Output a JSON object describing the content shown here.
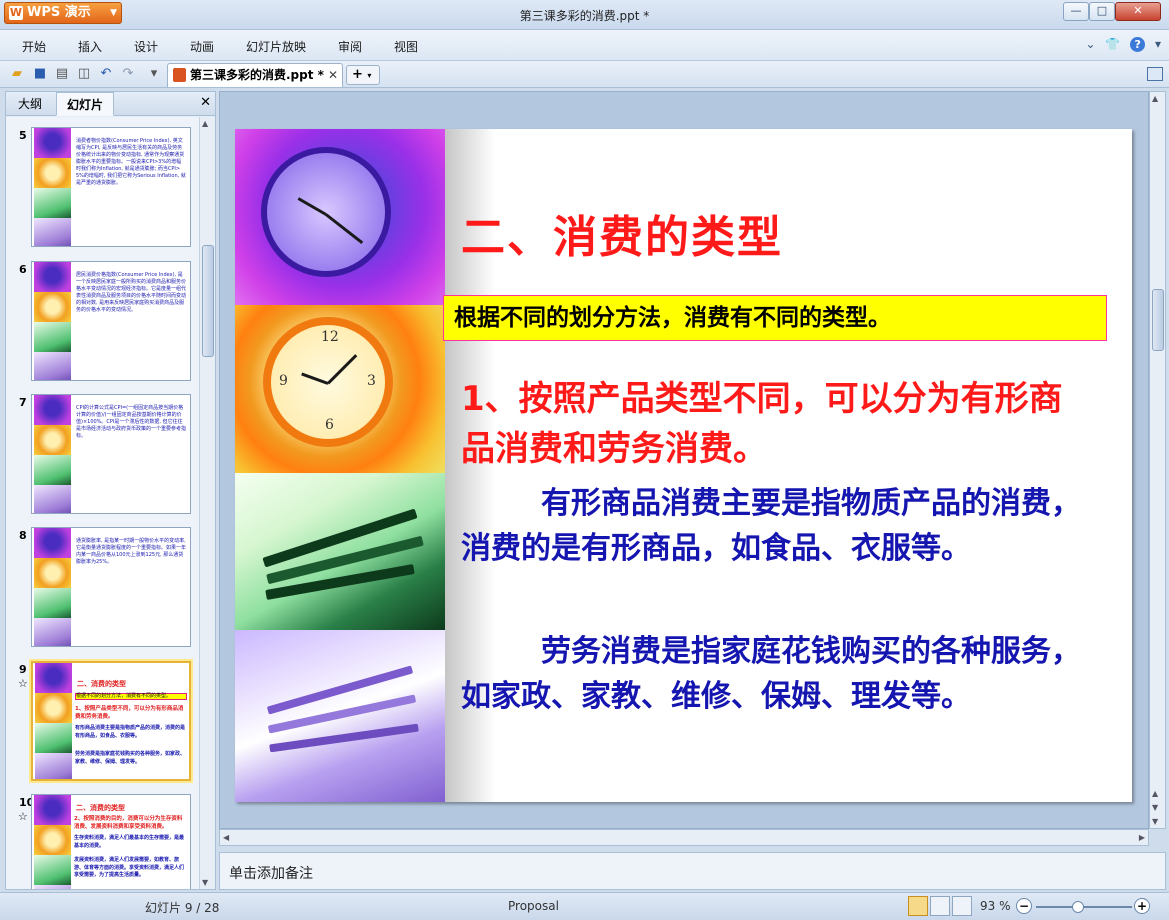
{
  "app": {
    "name": "WPS 演示",
    "document_title": "第三课多彩的消费.ppt *"
  },
  "menu": [
    "开始",
    "插入",
    "设计",
    "动画",
    "幻灯片放映",
    "审阅",
    "视图"
  ],
  "toolbar": {
    "doc_tab_label": "第三课多彩的消费.ppt *"
  },
  "left_panel": {
    "tabs": [
      "大纲",
      "幻灯片"
    ],
    "thumbnails": [
      {
        "number": "5",
        "text": "消费者物价指数(Consumer Price Index), 英文缩写为CPI, 是反映与居民生活有关的商品及劳务价格统计出来的物价变动指标, 通常作为观察通货膨胀水平的重要指标。一般说来CPI>3%的增幅时我们称为Inflation, 就是通货膨胀; 而当CPI>5%的增幅时, 我们把它称为Serious Inflation, 就是严重的通货膨胀。"
      },
      {
        "number": "6",
        "text": "居民消费价格指数(Consumer Price Index), 是一个反映居民家庭一般所购买的消费商品和服务价格水平变动情况的宏观经济指标。它是度量一组代表性消费商品及服务项目的价格水平随时间而变动的相对数, 是用来反映居民家庭购买消费商品及服务的价格水平的变动情况。"
      },
      {
        "number": "7",
        "text": "CPI的计算公式是CPI=(一组固定商品按当期价格计算的价值)/(一组固定商品按基期价格计算的价值)×100%。CPI是一个滞后性的数据, 但它往往是市场经济活动与政府货币政策的一个重要参考指标。"
      },
      {
        "number": "8",
        "text": "通货膨胀率, 是指某一时期一般物价水平的变动率, 它是衡量通货膨胀程度的一个重要指标。如果一年内某一商品价格从100元上涨到125元, 那么通货膨胀率为25%。"
      },
      {
        "number": "9",
        "title": "二、消费的类型",
        "box": "根据不同的划分方法，消费有不同的类型。",
        "point": "1、按照产品类型不同，可以分为有形商品消费和劳务消费。",
        "para1": "有形商品消费主要是指物质产品的消费，消费的是有形商品，如食品、衣服等。",
        "para2": "劳务消费是指家庭花钱购买的各种服务，如家政、家教、维修、保姆、理发等。",
        "selected": true
      },
      {
        "number": "10",
        "title": "二、消费的类型",
        "point": "2、按照消费的目的，消费可以分为生存资料消费、发展资料消费和享受资料消费。",
        "para1": "生存资料消费，满足人们最基本的生存需要，是最基本的消费。",
        "para2": "发展资料消费，满足人们发展需要，如教育、旅游、体育等方面的消费。享受资料消费，满足人们享受需要，为了提高生活质量。"
      }
    ]
  },
  "slide": {
    "title": "二、消费的类型",
    "intro_box": "根据不同的划分方法，消费有不同的类型。",
    "point1": "1、按照产品类型不同，可以分为有形商品消费和劳务消费。",
    "para1": "有形商品消费主要是指物质产品的消费，消费的是有形商品，如食品、衣服等。",
    "para2": "劳务消费是指家庭花钱购买的各种服务，如家政、家教、维修、保姆、理发等。",
    "colors": {
      "title": "#ff1a1a",
      "box_bg": "#ffff00",
      "body_blue": "#1515b0"
    }
  },
  "notes_placeholder": "单击添加备注",
  "status": {
    "slide_indicator": "幻灯片 9 / 28",
    "template": "Proposal",
    "zoom": "93 %"
  }
}
